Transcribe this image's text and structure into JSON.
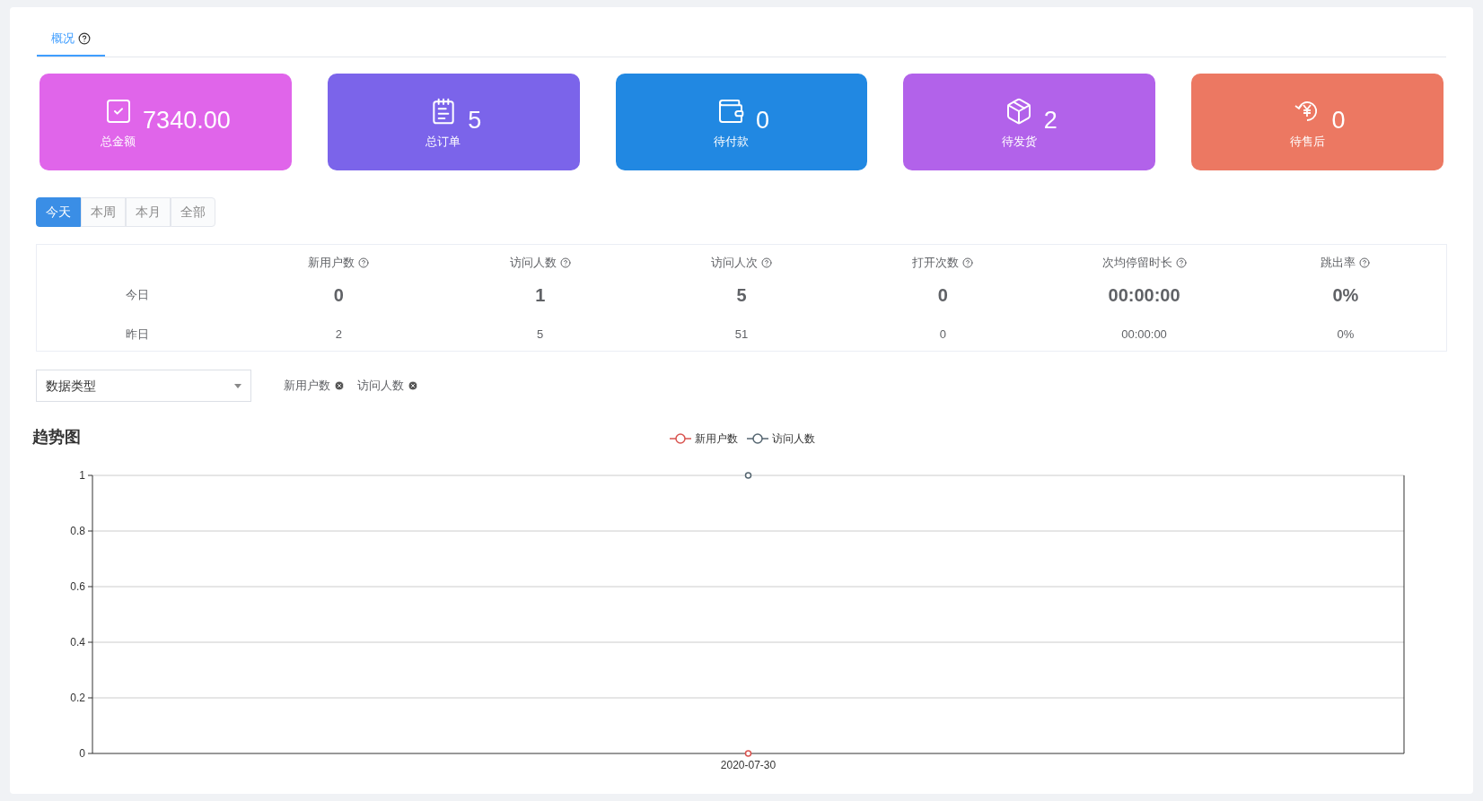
{
  "tabs": [
    {
      "label": "概况",
      "selected": true
    }
  ],
  "cards": [
    {
      "kind": "amount",
      "value": "7340.00",
      "label": "总金额",
      "color": "#e065ea"
    },
    {
      "kind": "orders",
      "value": "5",
      "label": "总订单",
      "color": "#7b64ea"
    },
    {
      "kind": "unpaid",
      "value": "0",
      "label": "待付款",
      "color": "#2188e2"
    },
    {
      "kind": "unshipped",
      "value": "2",
      "label": "待发货",
      "color": "#b262ea"
    },
    {
      "kind": "aftersale",
      "value": "0",
      "label": "待售后",
      "color": "#ec7862"
    }
  ],
  "periods": [
    {
      "label": "今天",
      "selected": true
    },
    {
      "label": "本周",
      "selected": false
    },
    {
      "label": "本月",
      "selected": false
    },
    {
      "label": "全部",
      "selected": false
    }
  ],
  "stats": {
    "columns": [
      "新用户数",
      "访问人数",
      "访问人次",
      "打开次数",
      "次均停留时长",
      "跳出率"
    ],
    "rows": [
      {
        "kind": "current",
        "label": "今日",
        "values": [
          "0",
          "1",
          "5",
          "0",
          "00:00:00",
          "0%"
        ]
      },
      {
        "kind": "previous",
        "label": "昨日",
        "values": [
          "2",
          "5",
          "51",
          "0",
          "00:00:00",
          "0%"
        ]
      }
    ]
  },
  "filter": {
    "placeholder": "数据类型",
    "tags": [
      "新用户数",
      "访问人数"
    ]
  },
  "trend": {
    "title": "趋势图",
    "chart_data": {
      "type": "line",
      "categories": [
        "2020-07-30"
      ],
      "grid": true,
      "series": [
        {
          "name": "新用户数",
          "color": "#d9534f",
          "marker": "circle",
          "values": [
            0
          ]
        },
        {
          "name": "访问人数",
          "color": "#546570",
          "marker": "circle",
          "values": [
            1
          ]
        }
      ],
      "ylim": [
        0,
        1
      ],
      "yticks": [
        0,
        0.2,
        0.4,
        0.6,
        0.8,
        1
      ]
    }
  }
}
